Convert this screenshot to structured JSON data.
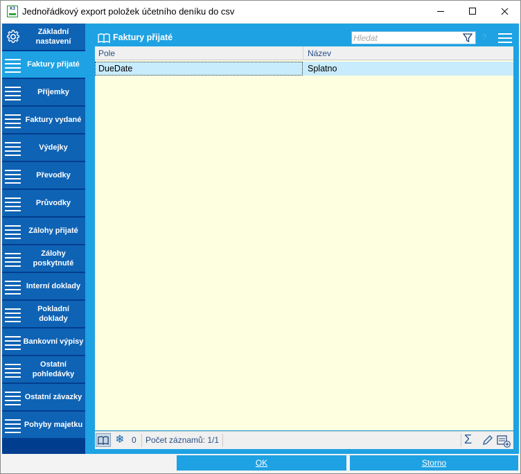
{
  "window": {
    "title": "Jednořádkový export položek účetního deníku do csv",
    "logo_text": "K3"
  },
  "sidebar": {
    "items": [
      {
        "label": "Základní nastavení",
        "icon": "gear-icon"
      },
      {
        "label": "Faktury přijaté",
        "icon": "list-icon",
        "active": true
      },
      {
        "label": "Příjemky",
        "icon": "list-icon"
      },
      {
        "label": "Faktury vydané",
        "icon": "list-icon"
      },
      {
        "label": "Výdejky",
        "icon": "list-icon"
      },
      {
        "label": "Převodky",
        "icon": "list-icon"
      },
      {
        "label": "Průvodky",
        "icon": "list-icon"
      },
      {
        "label": "Zálohy přijaté",
        "icon": "list-icon"
      },
      {
        "label": "Zálohy poskytnuté",
        "icon": "list-icon"
      },
      {
        "label": "Interní doklady",
        "icon": "list-icon"
      },
      {
        "label": "Pokladní doklady",
        "icon": "list-icon"
      },
      {
        "label": "Bankovní výpisy",
        "icon": "list-icon"
      },
      {
        "label": "Ostatní pohledávky",
        "icon": "list-icon"
      },
      {
        "label": "Ostatní závazky",
        "icon": "list-icon"
      },
      {
        "label": "Pohyby majetku",
        "icon": "list-icon"
      }
    ]
  },
  "panel": {
    "title": "Faktury přijaté",
    "search": {
      "placeholder": "Hledat",
      "value": ""
    },
    "columns": [
      "Pole",
      "Název"
    ],
    "rows": [
      {
        "pole": "DueDate",
        "nazev": "Splatno"
      }
    ]
  },
  "statusbar": {
    "selected_count": "0",
    "records_text": "Počet záznamů: 1/1",
    "sum_symbol": "Σ"
  },
  "footer": {
    "ok_label": "OK",
    "storno_label": "Storno"
  },
  "colors": {
    "sidebar_bg": "#003d8f",
    "nav_item_bg": "#0f63b4",
    "accent": "#1ea2e3",
    "grid_bg": "#fefee0",
    "selected_row": "#c8ecfb"
  }
}
